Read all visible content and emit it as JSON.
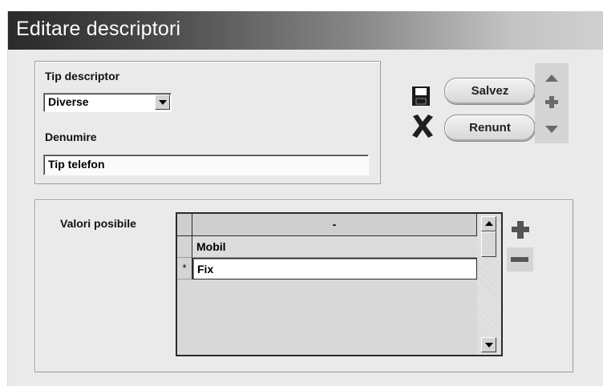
{
  "window": {
    "title": "Editare descriptori"
  },
  "form": {
    "tip_label": "Tip descriptor",
    "tip_value": "Diverse",
    "denumire_label": "Denumire",
    "denumire_value": "Tip telefon"
  },
  "actions": {
    "save_label": "Salvez",
    "cancel_label": "Renunt",
    "save_icon": "floppy-disk-icon",
    "cancel_icon": "x-mark-icon"
  },
  "nav": {
    "up_icon": "arrow-up-icon",
    "add_icon": "plus-icon",
    "down_icon": "arrow-down-icon"
  },
  "values": {
    "label": "Valori posibile",
    "column_header": "-",
    "rows": [
      {
        "marker": "",
        "value": "Mobil"
      },
      {
        "marker": "*",
        "value": "Fix"
      }
    ],
    "add_icon": "plus-icon",
    "remove_icon": "minus-icon"
  }
}
